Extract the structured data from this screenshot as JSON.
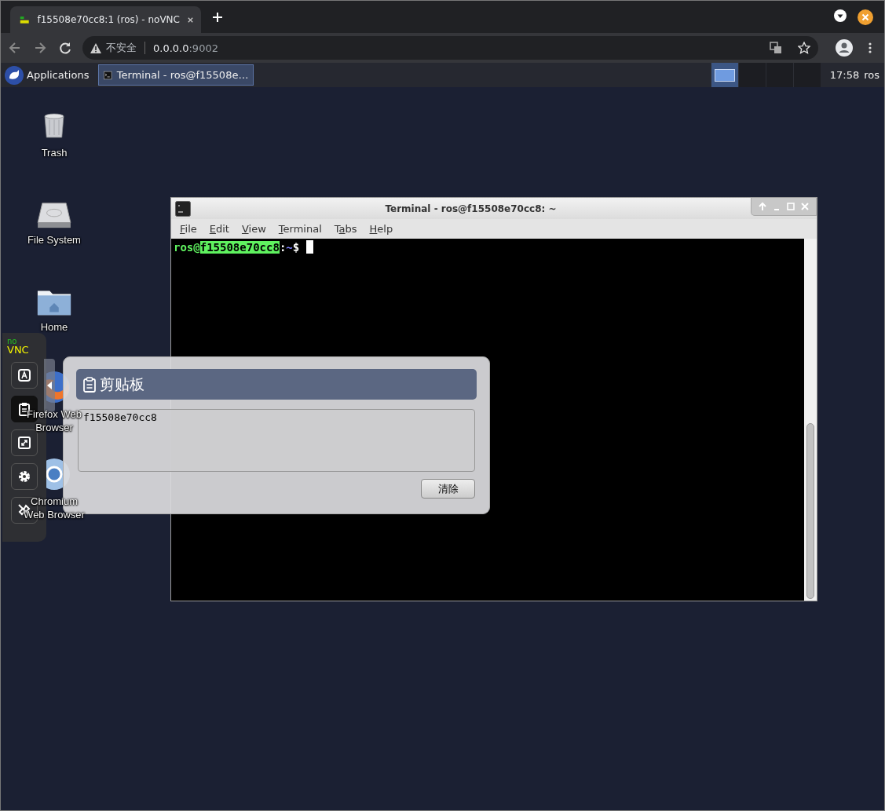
{
  "browser": {
    "tab": {
      "title": "f15508e70cc8:1 (ros) - noVNC"
    },
    "address": {
      "warning": "不安全",
      "host": "0.0.0.0",
      "port": ":9002"
    }
  },
  "panel": {
    "applications": "Applications",
    "tasks": [
      {
        "label": "Terminal - ros@f15508e…",
        "selected": true
      }
    ],
    "workspaces": [
      {
        "selected": true
      },
      {
        "selected": false
      },
      {
        "selected": false
      },
      {
        "selected": false
      }
    ],
    "clock": "17:58",
    "user": "ros"
  },
  "desktop_icons": [
    {
      "kind": "trash",
      "label": "Trash"
    },
    {
      "kind": "drive",
      "label": "File System"
    },
    {
      "kind": "home",
      "label": "Home"
    },
    {
      "kind": "firefox",
      "label": "Firefox Web Browser"
    },
    {
      "kind": "chromium",
      "label": "Chromium Web Browser"
    }
  ],
  "terminal": {
    "title": "Terminal - ros@f15508e70cc8: ~",
    "menu": [
      {
        "mnemonic": "F",
        "rest": "ile"
      },
      {
        "mnemonic": "E",
        "rest": "dit"
      },
      {
        "mnemonic": "V",
        "rest": "iew"
      },
      {
        "mnemonic": "T",
        "rest": "erminal"
      },
      {
        "before": "T",
        "mnemonic": "a",
        "rest": "bs"
      },
      {
        "mnemonic": "H",
        "rest": "elp"
      }
    ],
    "prompt": {
      "user": "ros@",
      "host": "f15508e70cc8",
      "separator": ":",
      "path": "~",
      "symbol": "$"
    }
  },
  "novnc": {
    "logo": {
      "top": "no",
      "bottom": "VNC"
    },
    "buttons": [
      {
        "kind": "keyboard",
        "selected": false
      },
      {
        "kind": "clipboard",
        "selected": true
      },
      {
        "kind": "fullscreen",
        "selected": false
      },
      {
        "kind": "settings",
        "selected": false
      },
      {
        "kind": "disconnect",
        "selected": false
      }
    ]
  },
  "clipboard": {
    "title": "剪贴板",
    "value": "f15508e70cc8",
    "button": "清除"
  }
}
